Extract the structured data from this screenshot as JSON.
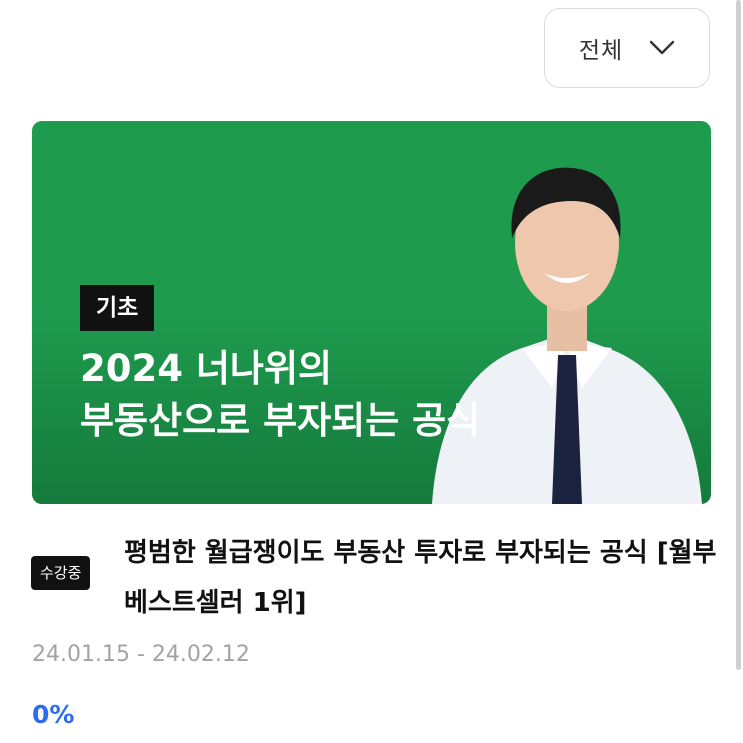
{
  "filter": {
    "label": "전체",
    "icon": "chevron-down-icon"
  },
  "course": {
    "banner": {
      "level_badge": "기초",
      "title": "2024 너나위의\n부동산으로 부자되는 공식",
      "background_color": "#1f9b4e"
    },
    "status_badge": "수강중",
    "title": "평범한 월급쟁이도 부동산 투자로 부자되는 공식 [월부 베스트셀러 1위]",
    "period": "24.01.15 - 24.02.12",
    "progress": "0%"
  },
  "colors": {
    "accent": "#2c6cf0",
    "badge_bg": "#111111"
  }
}
